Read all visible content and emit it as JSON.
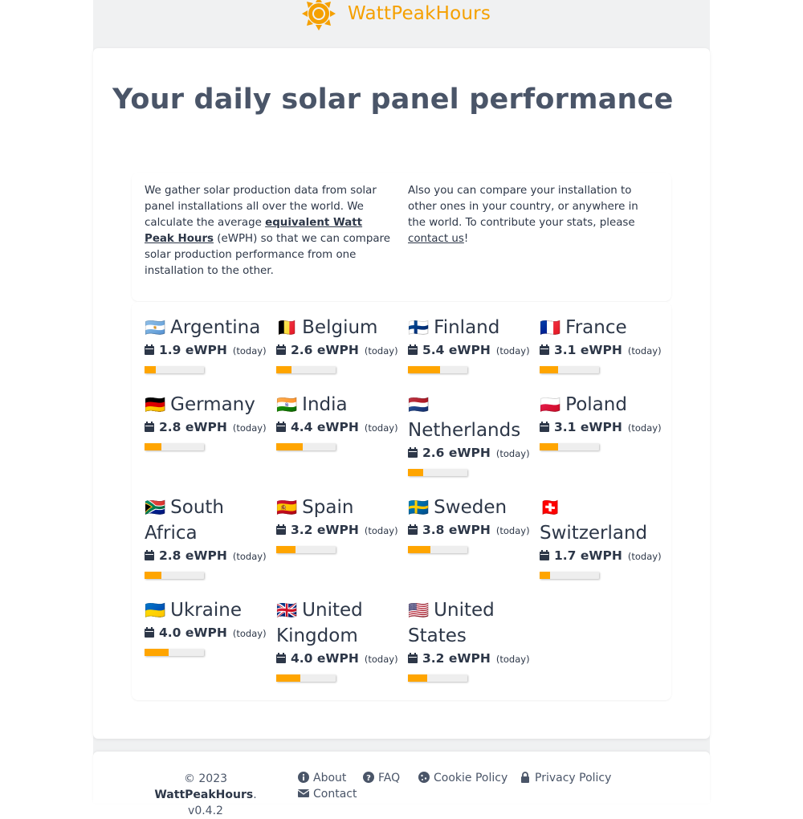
{
  "brand": "WattPeakHours",
  "title": "Your daily solar panel performance",
  "intro": {
    "p1_a": "We gather solar production data from solar panel installations all over the world. We calculate the average ",
    "p1_link": "equivalent Watt Peak Hours",
    "p1_b": " (eWPH) so that we can compare solar production performance from one installation to the other.",
    "p2_a": "Also you can compare your installation to other ones in your country, or anywhere in the world. To contribute your stats, please ",
    "p2_link": "contact us",
    "p2_b": "!"
  },
  "countries": [
    {
      "flag": "🇦🇷",
      "name": "Argentina",
      "value": "1.9 eWPH",
      "today": "(today)",
      "level": 0.19
    },
    {
      "flag": "🇧🇪",
      "name": "Belgium",
      "value": "2.6 eWPH",
      "today": "(today)",
      "level": 0.26
    },
    {
      "flag": "🇫🇮",
      "name": "Finland",
      "value": "5.4 eWPH",
      "today": "(today)",
      "level": 0.54
    },
    {
      "flag": "🇫🇷",
      "name": "France",
      "value": "3.1 eWPH",
      "today": "(today)",
      "level": 0.31
    },
    {
      "flag": "🇩🇪",
      "name": "Germany",
      "value": "2.8 eWPH",
      "today": "(today)",
      "level": 0.28
    },
    {
      "flag": "🇮🇳",
      "name": "India",
      "value": "4.4 eWPH",
      "today": "(today)",
      "level": 0.44
    },
    {
      "flag": "🇳🇱",
      "name": "Netherlands",
      "value": "2.6 eWPH",
      "today": "(today)",
      "level": 0.26
    },
    {
      "flag": "🇵🇱",
      "name": "Poland",
      "value": "3.1 eWPH",
      "today": "(today)",
      "level": 0.31
    },
    {
      "flag": "🇿🇦",
      "name": "South Africa",
      "value": "2.8 eWPH",
      "today": "(today)",
      "level": 0.28
    },
    {
      "flag": "🇪🇸",
      "name": "Spain",
      "value": "3.2 eWPH",
      "today": "(today)",
      "level": 0.32
    },
    {
      "flag": "🇸🇪",
      "name": "Sweden",
      "value": "3.8 eWPH",
      "today": "(today)",
      "level": 0.38
    },
    {
      "flag": "🇨🇭",
      "name": "Switzerland",
      "value": "1.7 eWPH",
      "today": "(today)",
      "level": 0.17
    },
    {
      "flag": "🇺🇦",
      "name": "Ukraine",
      "value": "4.0 eWPH",
      "today": "(today)",
      "level": 0.4
    },
    {
      "flag": "🇬🇧",
      "name": "United Kingdom",
      "value": "4.0 eWPH",
      "today": "(today)",
      "level": 0.4
    },
    {
      "flag": "🇺🇸",
      "name": "United States",
      "value": "3.2 eWPH",
      "today": "(today)",
      "level": 0.32
    }
  ],
  "footer": {
    "copyright_prefix": "© 2023 ",
    "copyright_brand": "WattPeakHours",
    "copyright_suffix": ".",
    "version": "v0.4.2",
    "links": {
      "about": "About",
      "faq": "FAQ",
      "cookie": "Cookie Policy",
      "privacy": "Privacy Policy",
      "contact": "Contact"
    },
    "icons": {
      "about": "info-icon",
      "faq": "question-icon",
      "cookie": "cookie-icon",
      "privacy": "lock-icon",
      "contact": "envelope-icon"
    }
  },
  "colors": {
    "accent": "#ffa500",
    "brand": "#f5a000",
    "title": "#4a5568",
    "text": "#2d3748"
  }
}
